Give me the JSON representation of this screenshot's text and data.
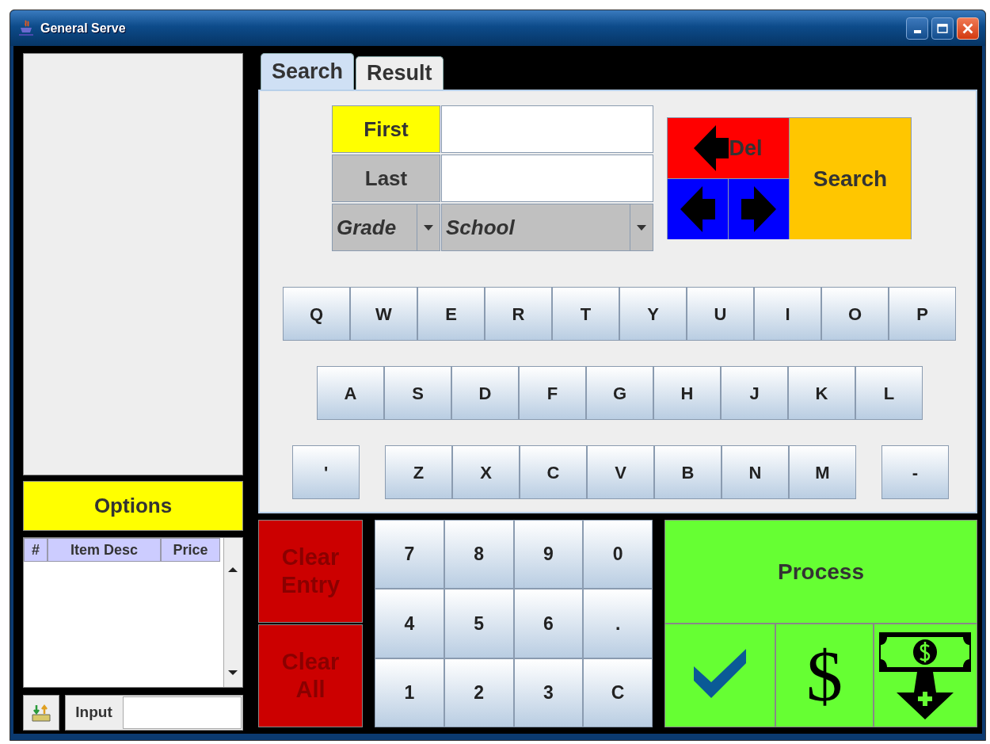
{
  "window": {
    "title": "General Serve"
  },
  "options_button": {
    "label": "Options"
  },
  "items_table": {
    "columns": [
      "#",
      "Item Desc",
      "Price"
    ]
  },
  "input": {
    "label": "Input"
  },
  "tabs": [
    {
      "label": "Search",
      "selected": true
    },
    {
      "label": "Result",
      "selected": false
    }
  ],
  "name_fields": [
    {
      "label": "First",
      "selected": true
    },
    {
      "label": "Last",
      "selected": false
    }
  ],
  "dropdowns": [
    {
      "value": "Grade"
    },
    {
      "value": "School"
    }
  ],
  "delete_button": {
    "label": "Del"
  },
  "search_button": {
    "label": "Search"
  },
  "keyboard": {
    "rows": [
      [
        "Q",
        "W",
        "E",
        "R",
        "T",
        "Y",
        "U",
        "I",
        "O",
        "P"
      ],
      [
        "A",
        "S",
        "D",
        "F",
        "G",
        "H",
        "J",
        "K",
        "L"
      ],
      [
        "'",
        "Z",
        "X",
        "C",
        "V",
        "B",
        "N",
        "M",
        "-"
      ]
    ]
  },
  "clear_buttons": [
    {
      "label": "Clear Entry"
    },
    {
      "label": "Clear All"
    }
  ],
  "numpad": [
    [
      "7",
      "8",
      "9",
      "0"
    ],
    [
      "4",
      "5",
      "6",
      "."
    ],
    [
      "1",
      "2",
      "3",
      "C"
    ]
  ],
  "process_button": {
    "label": "Process"
  },
  "payment_buttons": [
    {
      "kind": "check"
    },
    {
      "kind": "dollar",
      "text": "$"
    },
    {
      "kind": "cash"
    }
  ]
}
